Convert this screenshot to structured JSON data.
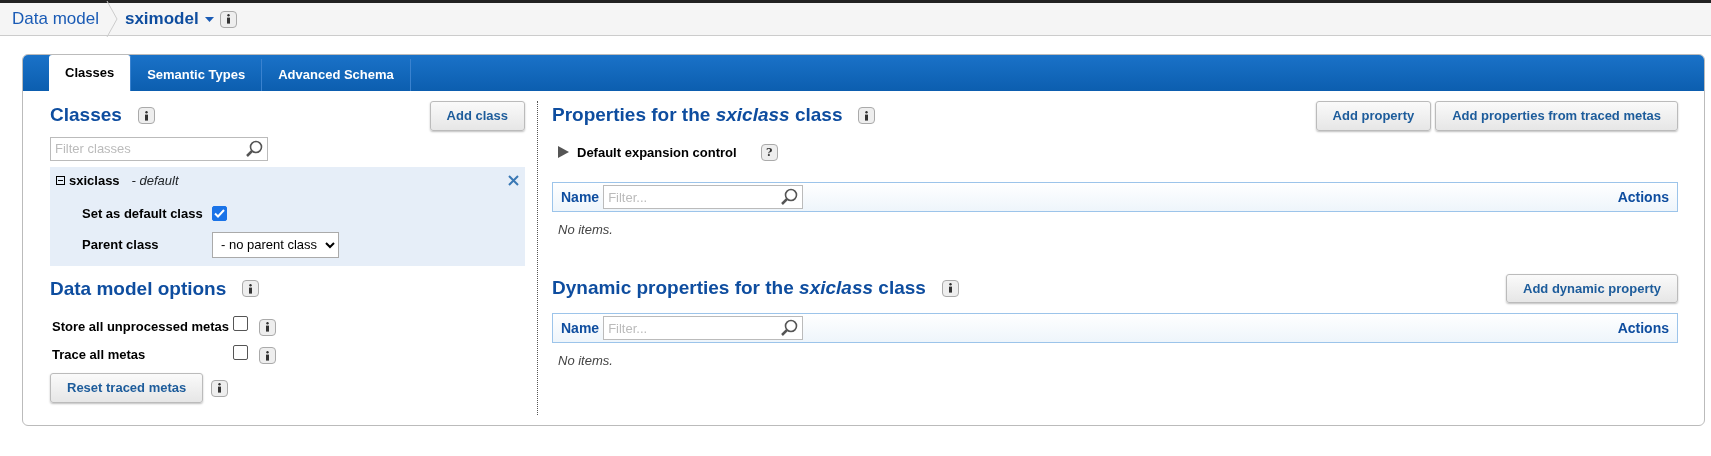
{
  "breadcrumb": {
    "items": [
      {
        "label": "Data model"
      },
      {
        "label": "sximodel",
        "dropdown": true
      }
    ]
  },
  "tabs": [
    {
      "label": "Classes",
      "selected": true
    },
    {
      "label": "Semantic Types",
      "selected": false
    },
    {
      "label": "Advanced Schema",
      "selected": false
    }
  ],
  "classes_panel": {
    "title": "Classes",
    "add_button": "Add class",
    "filter": {
      "placeholder": "Filter classes"
    },
    "classes": [
      {
        "name": "sxiclass",
        "note": "- default",
        "expanded": true,
        "default_label": "Set as default class",
        "is_default": true,
        "parent_label": "Parent class",
        "parent_value": "- no parent class"
      }
    ]
  },
  "options": {
    "title": "Data model options",
    "items": [
      {
        "label": "Store all unprocessed metas",
        "checked": false
      },
      {
        "label": "Trace all metas",
        "checked": false
      }
    ],
    "reset_button": "Reset traced metas"
  },
  "properties": {
    "title": "Properties for the *sxiclass* class",
    "buttons": [
      "Add property",
      "Add properties from traced metas"
    ],
    "expansion": {
      "label": "Default expansion control",
      "expanded": false,
      "help": "?"
    },
    "columns": [
      "Name",
      "Actions"
    ],
    "filter": {
      "placeholder": "Filter..."
    },
    "empty": "No items."
  },
  "dynamic": {
    "title": "Dynamic properties for the *sxiclass* class",
    "buttons": [
      "Add dynamic property"
    ],
    "columns": [
      "Name",
      "Actions"
    ],
    "filter": {
      "placeholder": "Filter..."
    },
    "empty": "No items."
  }
}
